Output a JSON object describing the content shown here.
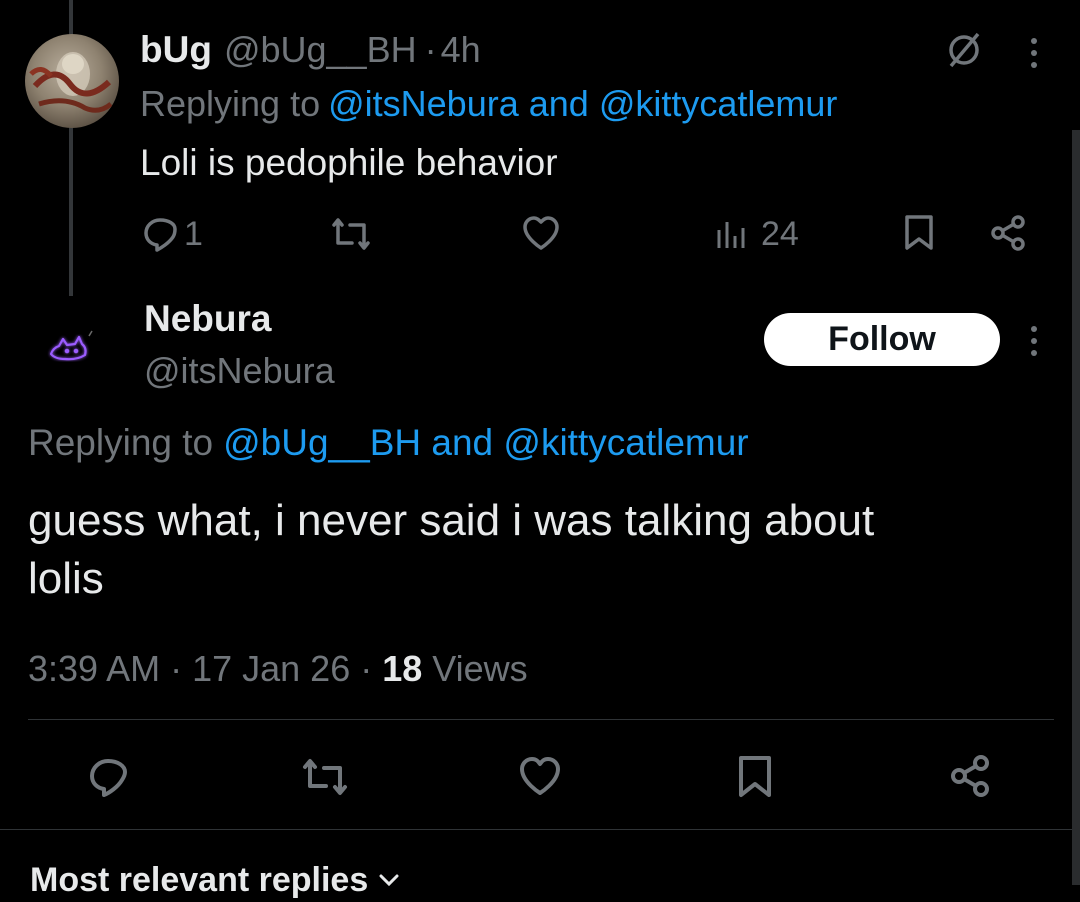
{
  "reply_tweet": {
    "display_name": "bUg",
    "handle": "@bUg__BH",
    "separator": "·",
    "time": "4h",
    "replying_prefix": "Replying to ",
    "replying_to_1": "@itsNebura",
    "replying_and": " and ",
    "replying_to_2": "@kittycatlemur",
    "text": "Loli is pedophile behavior",
    "reply_count": "1",
    "view_count": "24"
  },
  "main_tweet": {
    "display_name": "Nebura",
    "handle": "@itsNebura",
    "follow_label": "Follow",
    "replying_prefix": "Replying to ",
    "replying_to_1": "@bUg__BH",
    "replying_and": " and ",
    "replying_to_2": "@kittycatlemur",
    "text_line1": "guess what, i never said i was talking about",
    "text_line2": "lolis",
    "time": "3:39 AM",
    "sep1": " · ",
    "date": "17 Jan 26",
    "sep2": " · ",
    "views_count": "18",
    "views_label": " Views"
  },
  "footer": {
    "sort_label": "Most relevant replies",
    "sort_icon": "chevron-down-icon"
  },
  "colors": {
    "background": "#000000",
    "text": "#e7e9ea",
    "muted": "#71767b",
    "link": "#1d9bf0",
    "divider": "#2f3336",
    "purple_glow": "#8a4dff"
  }
}
